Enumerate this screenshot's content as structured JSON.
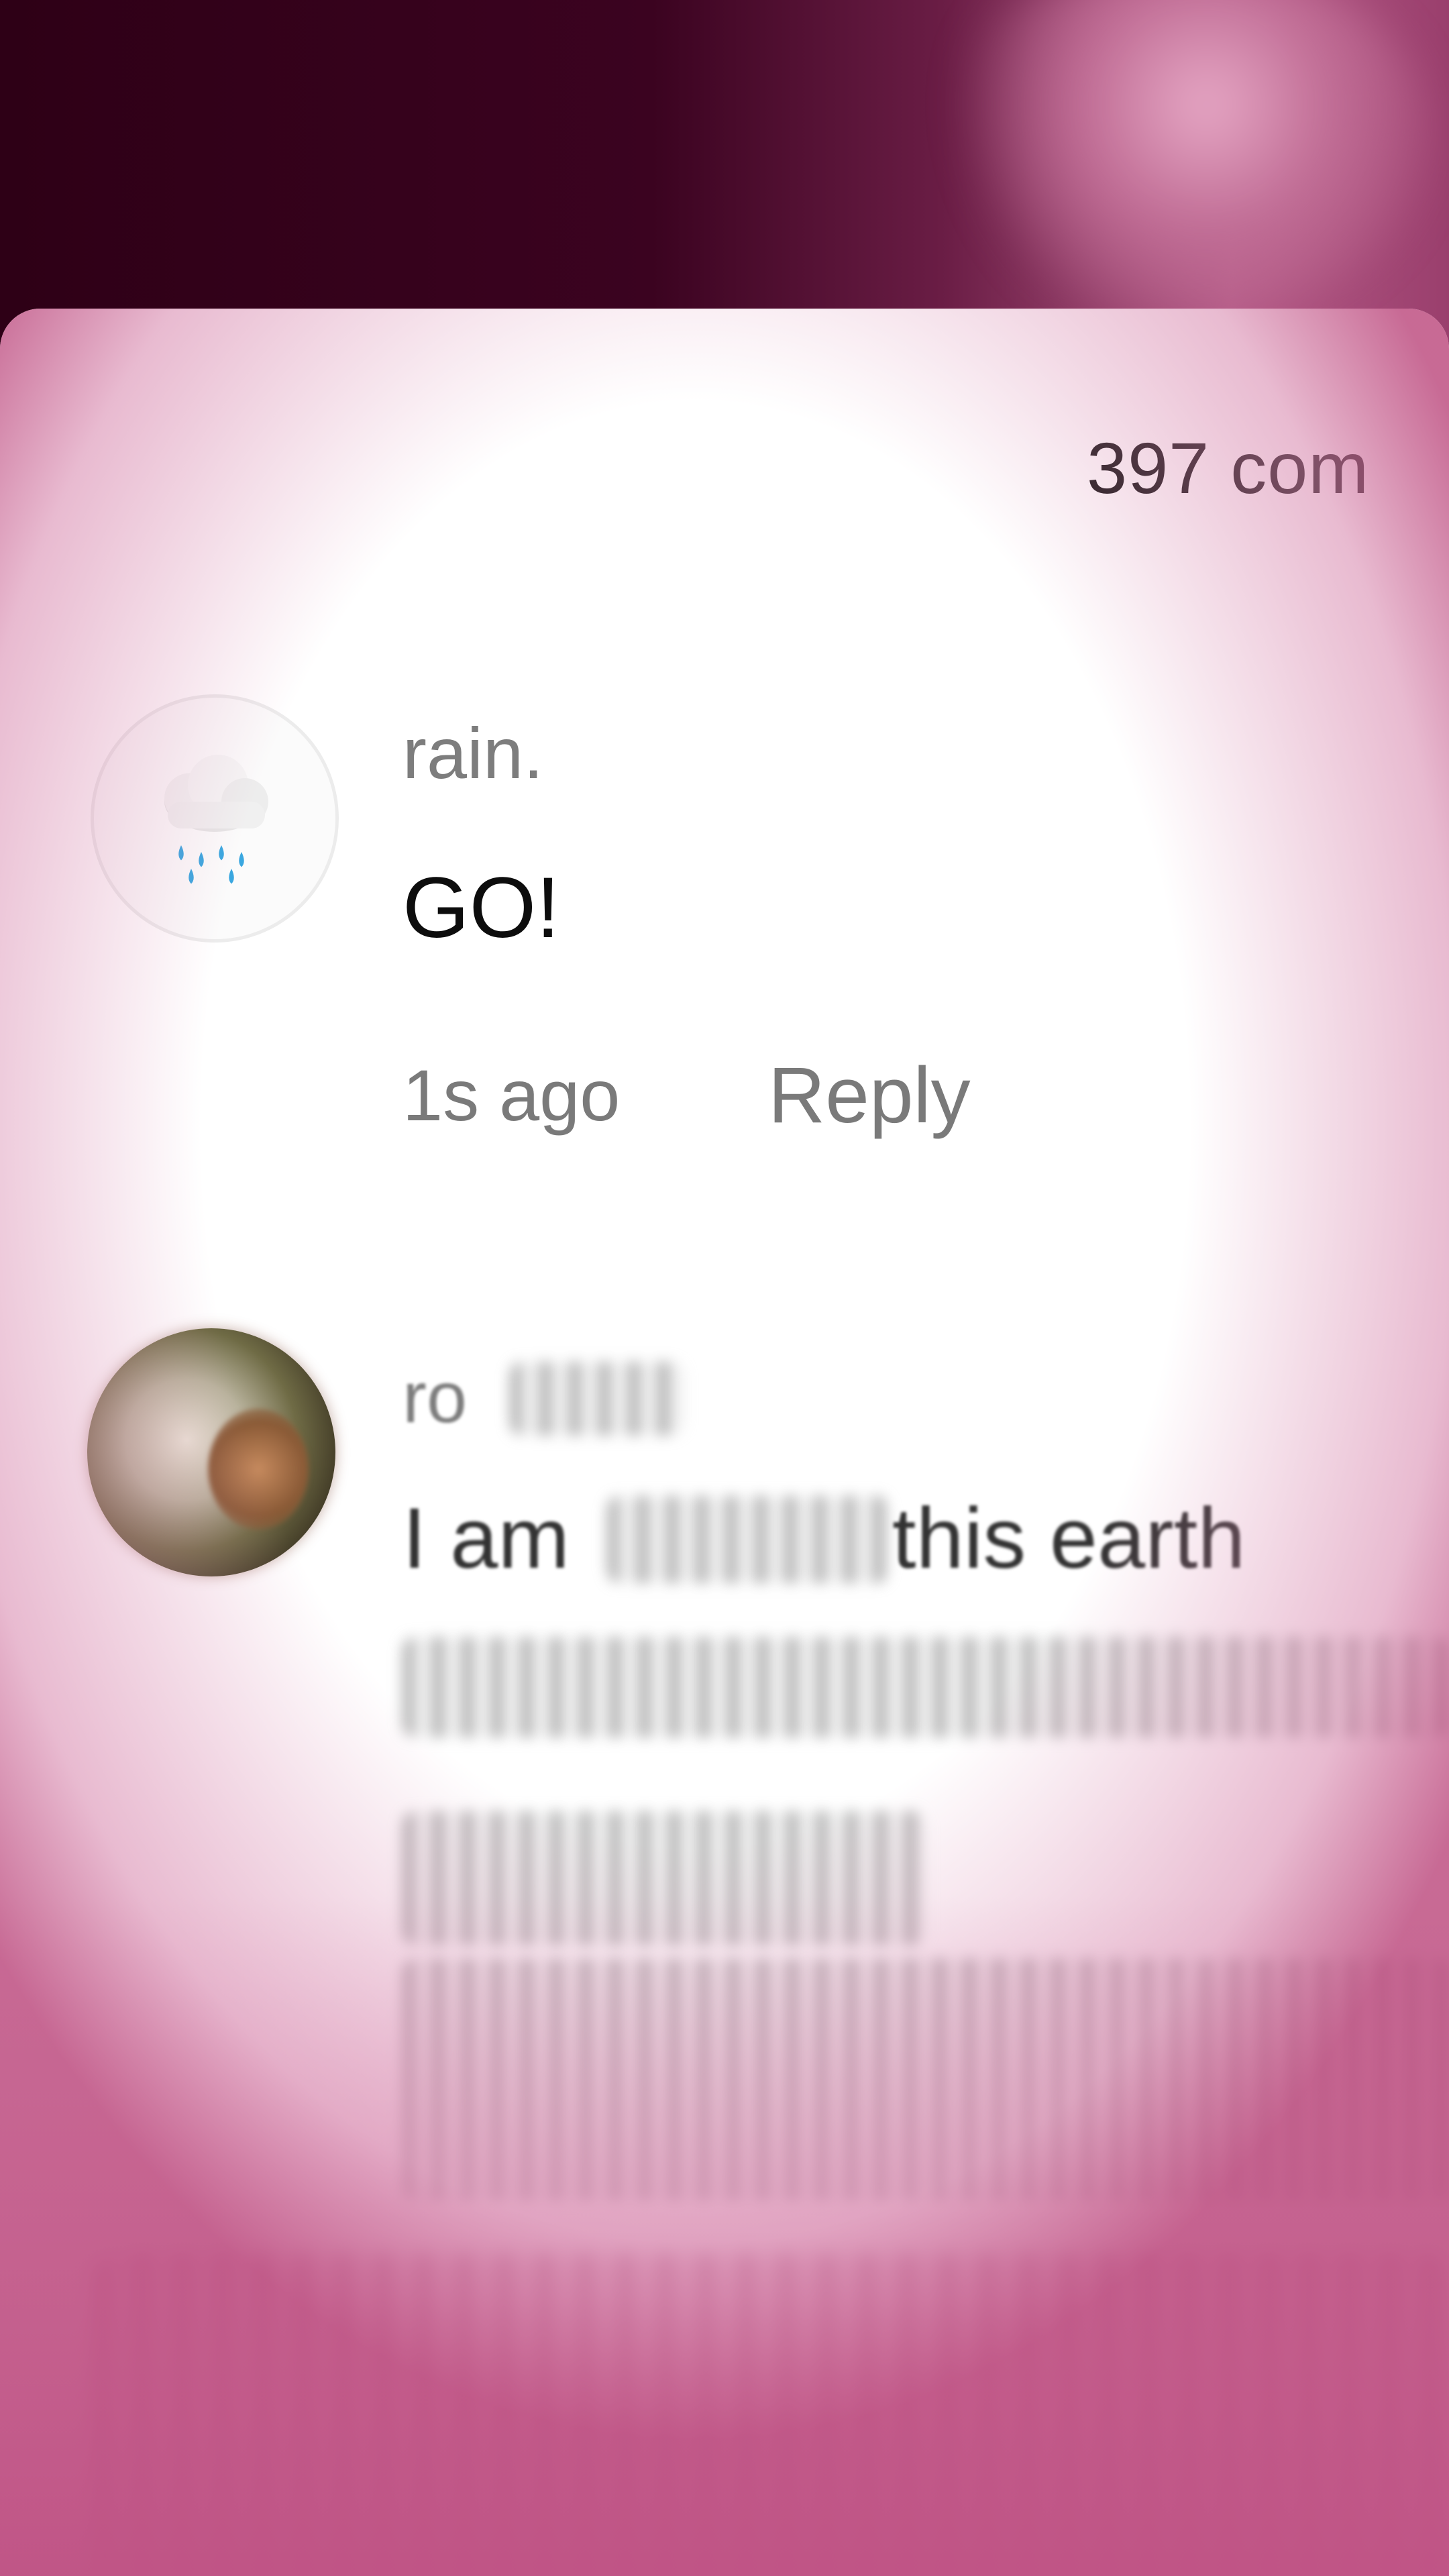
{
  "header": {
    "comment_count": "397 com"
  },
  "comments": [
    {
      "avatar_icon": "cloud-with-rain-icon",
      "username": "rain.",
      "text": "GO!",
      "time": "1s ago",
      "reply_label": "Reply"
    },
    {
      "avatar_icon": "profile-photo",
      "username": "ro",
      "text_start": "I am",
      "text_end": "this earth"
    }
  ],
  "colors": {
    "accent_pink": "#c06d95",
    "sheet_bg": "#ffffff",
    "text_primary": "#0d0d0d",
    "text_secondary": "#7a7a7a"
  }
}
